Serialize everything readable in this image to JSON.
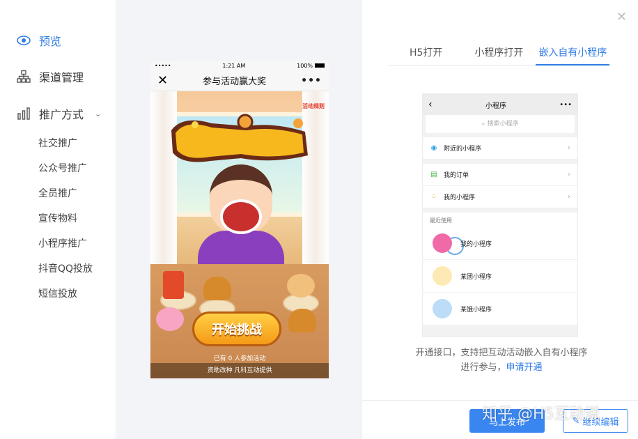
{
  "sidebar": {
    "preview_label": "预览",
    "channel_label": "渠道管理",
    "promo_label": "推广方式",
    "sub_items": [
      "社交推广",
      "公众号推广",
      "全员推广",
      "宣传物料",
      "小程序推广",
      "抖音QQ投放",
      "短信投放"
    ],
    "accent_color": "#2f7ce3"
  },
  "phone": {
    "carrier": "•••••",
    "time": "1:21 AM",
    "battery": "100%",
    "close_glyph": "✕",
    "title": "参与活动赢大奖",
    "more_glyph": "•••",
    "game_badge": "活动规则",
    "start_button": "开始挑战",
    "participants": "已有 0 人参加活动",
    "footer": "资助改种 凡科互动提供"
  },
  "right": {
    "close_glyph": "✕",
    "tabs": [
      "H5打开",
      "小程序打开",
      "嵌入自有小程序"
    ],
    "active_tab": "嵌入自有小程序",
    "mini": {
      "back_glyph": "‹",
      "title": "小程序",
      "more_glyph": "•••",
      "search_placeholder": "搜索小程序",
      "rows": [
        "附近的小程序",
        "我的订单",
        "我的小程序"
      ],
      "recent_label": "最近使用",
      "recent": [
        "我的小程序",
        "某团小程序",
        "某饿小程序"
      ]
    },
    "desc_line1": "开通接口，支持把互动活动嵌入自有小程序",
    "desc_line2_prefix": "进行参与，",
    "desc_link": "申请开通",
    "btn_publish": "马上发布",
    "btn_edit": "继续编辑",
    "watermark": "知乎 @H5互动说"
  }
}
